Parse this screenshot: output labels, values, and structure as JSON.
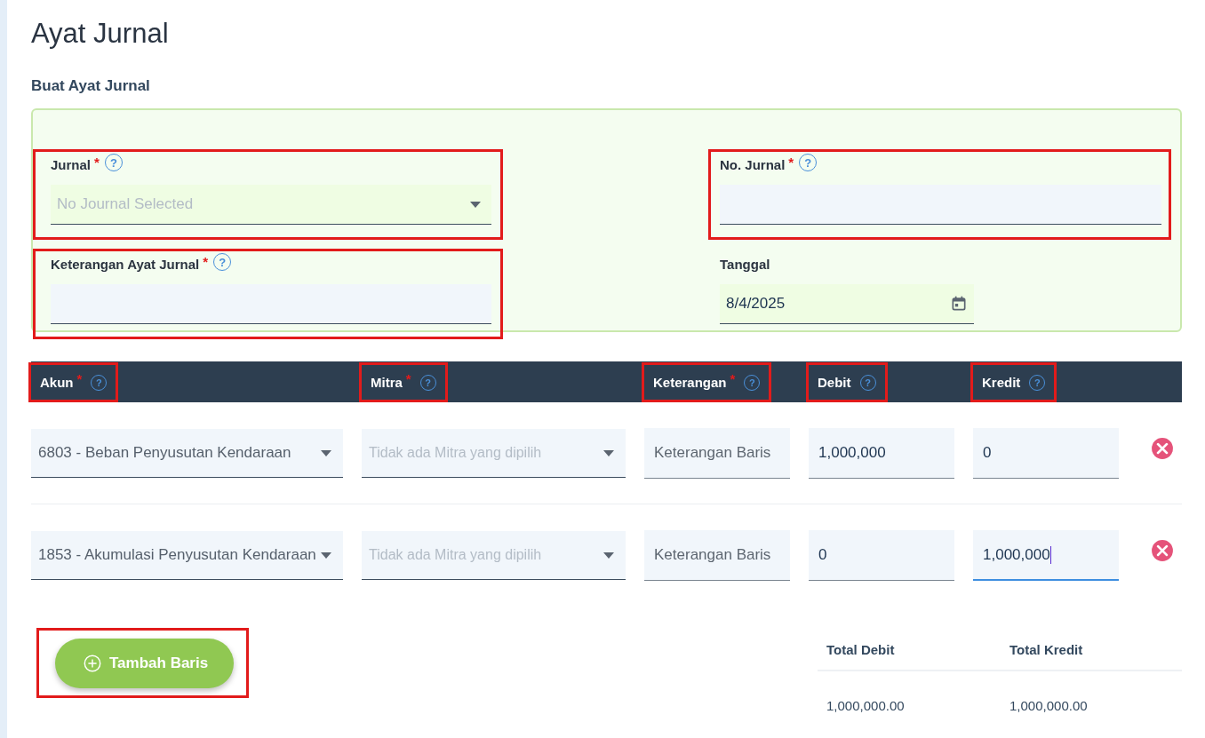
{
  "page": {
    "title": "Ayat Jurnal",
    "subtitle": "Buat Ayat Jurnal"
  },
  "form": {
    "fields": [
      {
        "kind": "select",
        "label": "Jurnal",
        "mark": "*",
        "help": "?",
        "placeholder": "No Journal Selected",
        "highlighted": true
      },
      {
        "kind": "text",
        "label": "No. Jurnal",
        "mark": "*",
        "help": "?",
        "highlighted": true
      },
      {
        "kind": "text",
        "label": "Keterangan Ayat Jurnal",
        "mark": "*",
        "help": "?",
        "highlighted": true
      },
      {
        "kind": "date",
        "label": "Tanggal",
        "value": "8/4/2025",
        "highlighted": false
      }
    ]
  },
  "table": {
    "columns": [
      {
        "label": "Akun",
        "mark": "*",
        "help": "?",
        "highlighted": true
      },
      {
        "label": "Mitra",
        "mark": "*",
        "help": "?",
        "highlighted": true
      },
      {
        "label": "Keterangan",
        "mark": "*",
        "help": "?",
        "highlighted": true
      },
      {
        "label": "Debit",
        "help": "?",
        "highlighted": true
      },
      {
        "label": "Kredit",
        "help": "?",
        "highlighted": true
      }
    ],
    "rows": [
      {
        "account": "6803 - Beban Penyusutan Kendaraan",
        "partner_placeholder": "Tidak ada Mitra yang dipilih",
        "description_placeholder": "Keterangan Baris",
        "debit": {
          "value": "1,000,000",
          "focused": false
        },
        "credit": {
          "value": "0",
          "focused": false
        }
      },
      {
        "account": "1853 - Akumulasi Penyusutan Kendaraan",
        "partner_placeholder": "Tidak ada Mitra yang dipilih",
        "description_placeholder": "Keterangan Baris",
        "debit": {
          "value": "0",
          "focused": false
        },
        "credit": {
          "value": "1,000,000",
          "focused": true
        }
      }
    ]
  },
  "add_button": {
    "label": "Tambah Baris",
    "highlighted": true
  },
  "totals": {
    "columns": [
      {
        "label": "Total Debit",
        "value": "1,000,000.00"
      },
      {
        "label": "Total Kredit",
        "value": "1,000,000.00"
      }
    ]
  }
}
